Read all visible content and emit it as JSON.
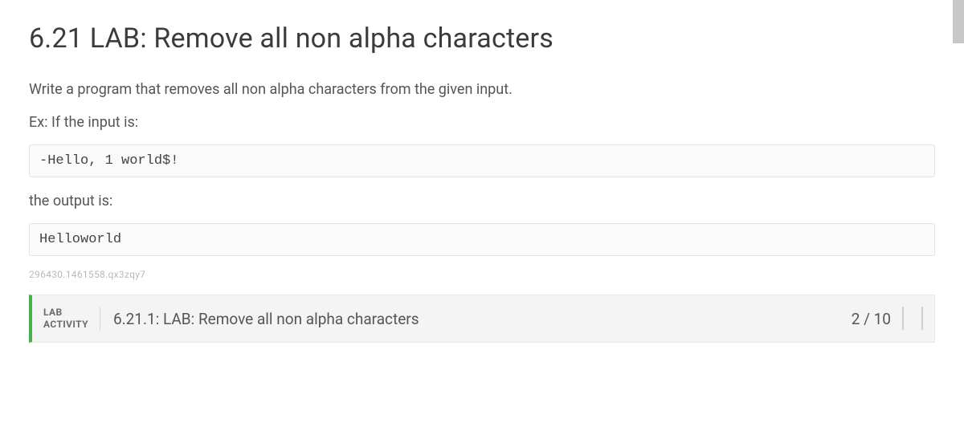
{
  "title": "6.21 LAB: Remove all non alpha characters",
  "instructions": "Write a program that removes all non alpha characters from the given input.",
  "example_intro": "Ex: If the input is:",
  "example_input": "-Hello, 1 world$!",
  "output_intro": "the output is:",
  "example_output": "Helloworld",
  "trace_id": "296430.1461558.qx3zqy7",
  "activity": {
    "tag_line1": "LAB",
    "tag_line2": "ACTIVITY",
    "title": "6.21.1: LAB: Remove all non alpha characters",
    "score": "2 / 10"
  }
}
